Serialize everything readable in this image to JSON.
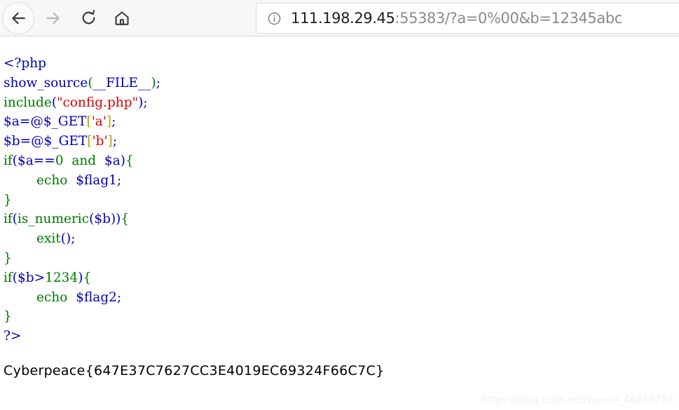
{
  "browser": {
    "nav": {
      "back_label": "Back",
      "forward_label": "Forward",
      "reload_label": "Reload",
      "home_label": "Home"
    },
    "url_bar": {
      "info_icon": "info-circle-icon",
      "host": "111.198.29.45",
      "rest": ":55383/?a=0%00&b=12345abc",
      "full_url": "111.198.29.45:55383/?a=0%00&b=12345abc"
    }
  },
  "page": {
    "code_lines": [
      [
        {
          "t": "<?php",
          "c": "d"
        }
      ],
      [
        {
          "t": "show_source",
          "c": "d"
        },
        {
          "t": "(",
          "c": "k"
        },
        {
          "t": "__FILE__",
          "c": "d"
        },
        {
          "t": ")",
          "c": "k"
        },
        {
          "t": ";",
          "c": "d"
        }
      ],
      [
        {
          "t": "include",
          "c": "k"
        },
        {
          "t": "(",
          "c": "d"
        },
        {
          "t": "\"config.php\"",
          "c": "s"
        },
        {
          "t": ")",
          "c": "d"
        },
        {
          "t": ";",
          "c": "d"
        }
      ],
      [
        {
          "t": "$a",
          "c": "d"
        },
        {
          "t": "=@",
          "c": "d"
        },
        {
          "t": "$_GET",
          "c": "d"
        },
        {
          "t": "[",
          "c": "c"
        },
        {
          "t": "'a'",
          "c": "s"
        },
        {
          "t": "]",
          "c": "c"
        },
        {
          "t": ";",
          "c": "d"
        }
      ],
      [
        {
          "t": "$b",
          "c": "d"
        },
        {
          "t": "=@",
          "c": "d"
        },
        {
          "t": "$_GET",
          "c": "d"
        },
        {
          "t": "[",
          "c": "c"
        },
        {
          "t": "'b'",
          "c": "s"
        },
        {
          "t": "]",
          "c": "c"
        },
        {
          "t": ";",
          "c": "d"
        }
      ],
      [
        {
          "t": "if",
          "c": "k"
        },
        {
          "t": "(",
          "c": "d"
        },
        {
          "t": "$a",
          "c": "d"
        },
        {
          "t": "==",
          "c": "d"
        },
        {
          "t": "0",
          "c": "k"
        },
        {
          "t": "  ",
          "c": "t"
        },
        {
          "t": "and",
          "c": "k"
        },
        {
          "t": "  ",
          "c": "t"
        },
        {
          "t": "$a",
          "c": "d"
        },
        {
          "t": ")",
          "c": "d"
        },
        {
          "t": "{",
          "c": "k"
        }
      ],
      [
        {
          "t": "        ",
          "c": "t"
        },
        {
          "t": "echo",
          "c": "k"
        },
        {
          "t": "  ",
          "c": "t"
        },
        {
          "t": "$flag1",
          "c": "d"
        },
        {
          "t": ";",
          "c": "d"
        }
      ],
      [
        {
          "t": "}",
          "c": "k"
        }
      ],
      [
        {
          "t": "if",
          "c": "k"
        },
        {
          "t": "(",
          "c": "d"
        },
        {
          "t": "is_numeric",
          "c": "k"
        },
        {
          "t": "(",
          "c": "d"
        },
        {
          "t": "$b",
          "c": "d"
        },
        {
          "t": "))",
          "c": "d"
        },
        {
          "t": "{",
          "c": "k"
        }
      ],
      [
        {
          "t": "        ",
          "c": "t"
        },
        {
          "t": "exit",
          "c": "k"
        },
        {
          "t": "()",
          "c": "d"
        },
        {
          "t": ";",
          "c": "d"
        }
      ],
      [
        {
          "t": "}",
          "c": "k"
        }
      ],
      [
        {
          "t": "if",
          "c": "k"
        },
        {
          "t": "(",
          "c": "d"
        },
        {
          "t": "$b",
          "c": "d"
        },
        {
          "t": ">",
          "c": "d"
        },
        {
          "t": "1234",
          "c": "k"
        },
        {
          "t": ")",
          "c": "d"
        },
        {
          "t": "{",
          "c": "k"
        }
      ],
      [
        {
          "t": "        ",
          "c": "t"
        },
        {
          "t": "echo",
          "c": "k"
        },
        {
          "t": "  ",
          "c": "t"
        },
        {
          "t": "$flag2",
          "c": "d"
        },
        {
          "t": ";",
          "c": "d"
        }
      ],
      [
        {
          "t": "}",
          "c": "k"
        }
      ],
      [
        {
          "t": "?>",
          "c": "d"
        }
      ]
    ],
    "flag": "Cyberpeace{647E37C7627CC3E4019EC69324F66C7C}",
    "watermark": "https://blog.csdn.net/weixin_44236278"
  },
  "colors": {
    "php_keyword": "#007700",
    "php_default": "#0000bb",
    "php_string": "#dd0000",
    "php_bracket": "#aaaa00",
    "url_host": "#1f1f1f",
    "url_rest": "#8a8a8a",
    "toolbar_bg": "#f7f7f7",
    "watermark": "#efefef"
  }
}
